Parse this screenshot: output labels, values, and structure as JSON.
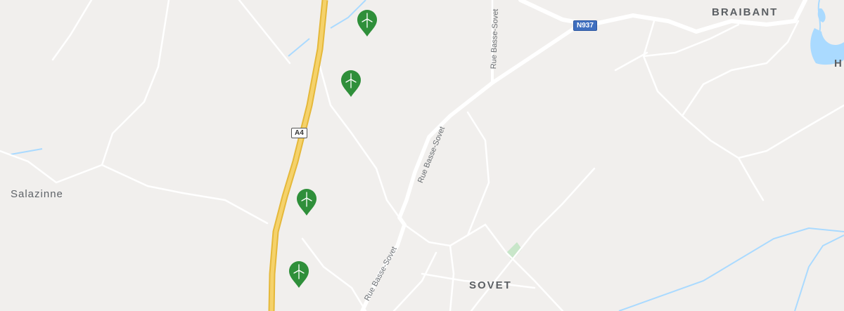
{
  "map": {
    "labels": {
      "town_braibant": "BRAIBANT",
      "town_sovet": "SOVET",
      "place_salazinne": "Salazinne",
      "edge_fragment": "H"
    },
    "streets": {
      "rue_basse_sovet_1": "Rue Basse-Sovet",
      "rue_basse_sovet_2": "Rue Basse-Sovet",
      "rue_basse_sovet_3": "Rue Basse-Sovet"
    },
    "shields": {
      "a4": "A4",
      "n937": "N937"
    },
    "markers": [
      {
        "id": "wind-turbine-1",
        "icon": "wind-turbine-icon"
      },
      {
        "id": "wind-turbine-2",
        "icon": "wind-turbine-icon"
      },
      {
        "id": "wind-turbine-3",
        "icon": "wind-turbine-icon"
      },
      {
        "id": "wind-turbine-4",
        "icon": "wind-turbine-icon"
      }
    ],
    "colors": {
      "land": "#f1efed",
      "road": "#ffffff",
      "motorway": "#f2c94c",
      "water": "#aadaff",
      "park": "#c8e6c9",
      "marker": "#2f8f3a"
    }
  }
}
